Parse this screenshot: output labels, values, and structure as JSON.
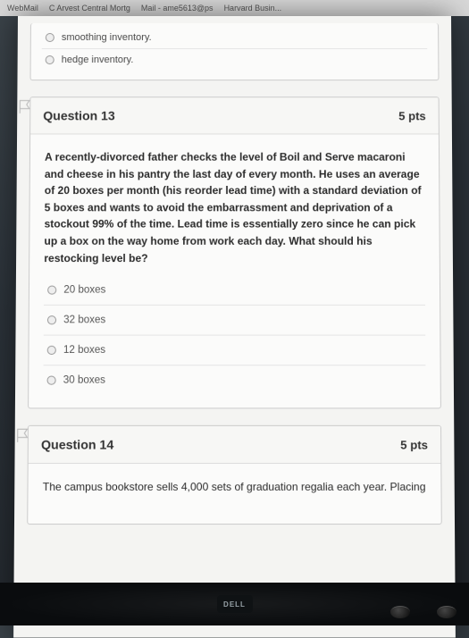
{
  "tabs": [
    "WebMail",
    "C  Arvest Central Mortg",
    "Mail - ame5613@ps",
    "Harvard Busin..."
  ],
  "prev_question": {
    "options": [
      "smoothing inventory.",
      "hedge inventory."
    ]
  },
  "q13": {
    "title": "Question 13",
    "pts": "5 pts",
    "text": "A recently-divorced father checks the level of Boil and Serve macaroni and cheese in his pantry the last day of every month. He uses an average of 20 boxes per month (his reorder lead time) with a standard deviation of 5 boxes and wants to avoid the embarrassment and deprivation of a stockout 99% of the time. Lead time is essentially zero since he can pick up a box on the way home from work each day. What should his restocking level be?",
    "options": [
      "20 boxes",
      "32 boxes",
      "12 boxes",
      "30 boxes"
    ]
  },
  "q14": {
    "title": "Question 14",
    "pts": "5 pts",
    "text": "The campus bookstore sells 4,000 sets of graduation regalia each year. Placing"
  },
  "logo": "DELL"
}
